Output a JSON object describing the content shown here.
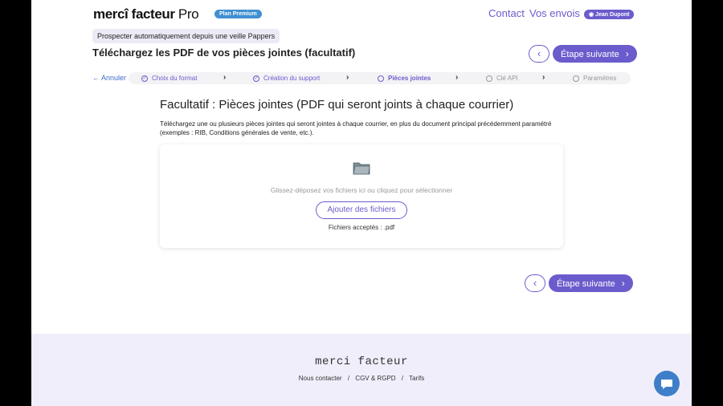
{
  "header": {
    "logo_main": "mercî facteur",
    "logo_pro": "Pro",
    "plan_badge": "Plan Premium",
    "nav": {
      "contact": "Contact",
      "envois": "Vos envois"
    },
    "user_badge": "Jean Dupont"
  },
  "context_chip": "Prospecter automatiquement depuis une veille Pappers",
  "page_title": "Téléchargez les PDF de vos pièces jointes (facultatif)",
  "buttons": {
    "back_symbol": "‹",
    "next_label": "Étape suivante",
    "next_symbol": "›"
  },
  "stepper": {
    "cancel_label": "Annuler",
    "steps": [
      {
        "label": "Choix du format",
        "state": "done"
      },
      {
        "label": "Création du support",
        "state": "done"
      },
      {
        "label": "Pièces jointes",
        "state": "current"
      },
      {
        "label": "Clé API",
        "state": "todo"
      },
      {
        "label": "Paramètres",
        "state": "todo"
      }
    ]
  },
  "section": {
    "title": "Facultatif : Pièces jointes (PDF qui seront joints à chaque courrier)",
    "description": "Téléchargez une ou plusieurs pièces jointes qui seront jointes à chaque courrier, en plus du document principal précédemment paramétré (exemples : RIB, Conditions générales de vente, etc.)."
  },
  "dropzone": {
    "icon": "folder-icon",
    "hint": "Glissez-déposez vos fichiers ici ou cliquez pour sélectionner",
    "add_button": "Ajouter des fichiers",
    "accepted": "Fichiers acceptés : .pdf"
  },
  "footer": {
    "logo": "merci facteur",
    "links": [
      "Nous contacter",
      "CGV & RGPD",
      "Tarifs"
    ],
    "separator": "/"
  },
  "colors": {
    "accent": "#6a5ccc",
    "plan_badge": "#3f8fd2",
    "footer_bg": "#f1eefb",
    "chat": "#3f7ec9"
  }
}
